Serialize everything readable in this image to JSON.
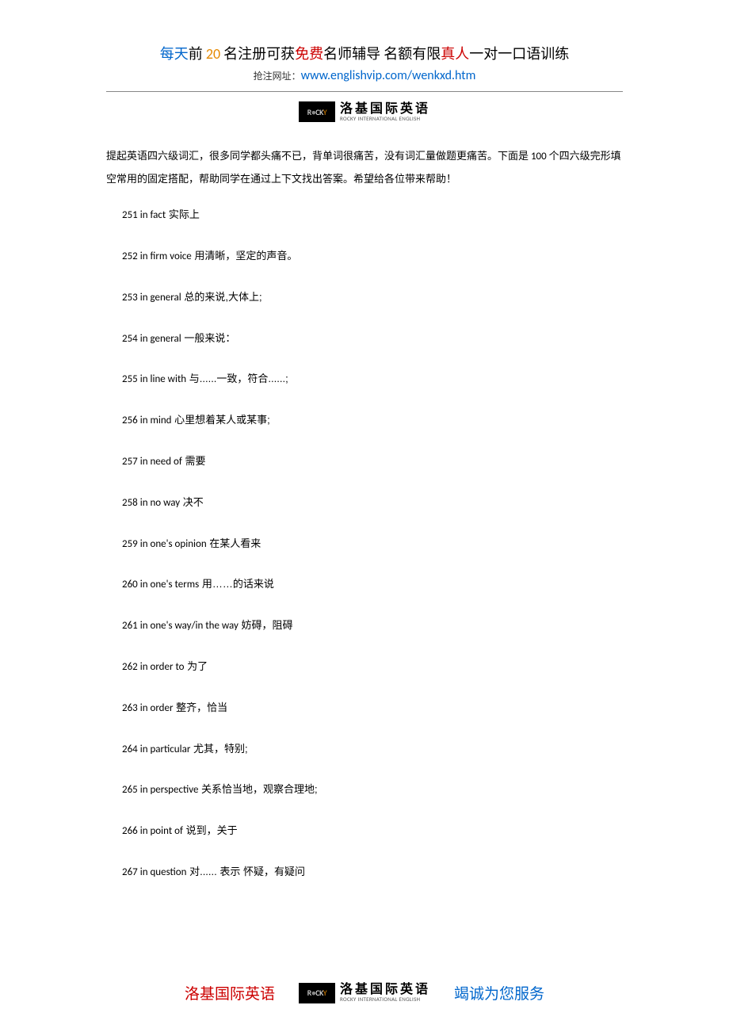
{
  "header": {
    "line1": {
      "part1": "每天",
      "part2": "前",
      "part3": " 20 ",
      "part4": "名",
      "part5": "注册可获",
      "part6": "免费",
      "part7": "名师辅导    名额有限",
      "part8": "真人",
      "part9": "一对一口语训练"
    },
    "line2_label": "抢注网址：",
    "url": "www.englishvip.com/wenkxd.htm"
  },
  "logo": {
    "mark_left": "R",
    "mark_mid": "CK",
    "mark_y": "Y",
    "cn": "洛基国际英语",
    "en": "ROCKY INTERNATIONAL ENGLISH"
  },
  "intro": "提起英语四六级词汇，很多同学都头痛不已，背单词很痛苦，没有词汇量做题更痛苦。下面是 100 个四六级完形填空常用的固定搭配，帮助同学在通过上下文找出答案。希望给各位带来帮助！",
  "entries": [
    {
      "num": "251",
      "en": "in fact",
      "cn": " 实际上"
    },
    {
      "num": "252",
      "en": "in firm voice",
      "cn": " 用清晰，坚定的声音。"
    },
    {
      "num": "253",
      "en": "in general",
      "cn": " 总的来说,大体上;"
    },
    {
      "num": "254",
      "en": "in general",
      "cn": " 一般来说："
    },
    {
      "num": "255",
      "en": "in line with",
      "cn": " 与......一致，符合......;"
    },
    {
      "num": "256",
      "en": "in mind",
      "cn": " 心里想着某人或某事;"
    },
    {
      "num": "257",
      "en": "in need of",
      "cn": " 需要"
    },
    {
      "num": "258",
      "en": "in no way",
      "cn": " 决不"
    },
    {
      "num": "259",
      "en": "in one's opinion",
      "cn": " 在某人看来"
    },
    {
      "num": "260",
      "en": "in one's terms",
      "cn": " 用……的话来说"
    },
    {
      "num": "261",
      "en": "in one's way/in the way",
      "cn": " 妨碍，阻碍"
    },
    {
      "num": "262",
      "en": "in order to",
      "cn": " 为了"
    },
    {
      "num": "263",
      "en": "in order",
      "cn": " 整齐，恰当"
    },
    {
      "num": "264",
      "en": "in particular",
      "cn": " 尤其，特别;"
    },
    {
      "num": "265",
      "en": "in perspective",
      "cn": " 关系恰当地，观察合理地;"
    },
    {
      "num": "266",
      "en": "in point of",
      "cn": " 说到，关于"
    },
    {
      "num": "267",
      "en": "in question",
      "cn": " 对...... 表示 怀疑，有疑问"
    }
  ],
  "footer": {
    "left": "洛基国际英语",
    "right": "竭诚为您服务"
  }
}
